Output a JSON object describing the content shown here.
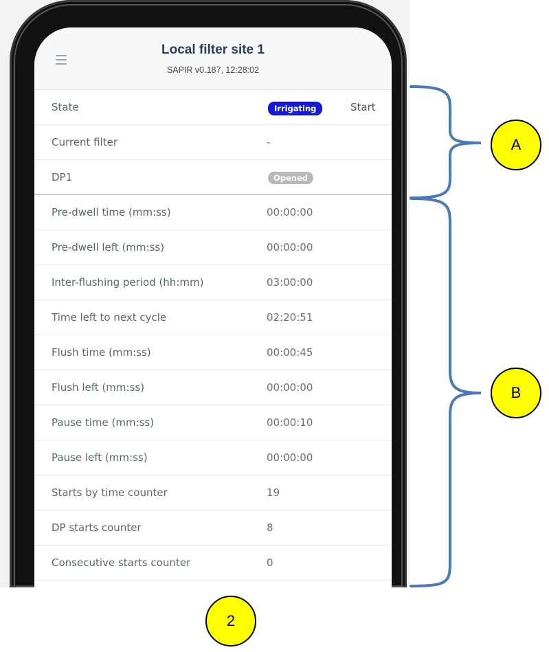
{
  "header": {
    "title": "Local filter site 1",
    "subtitle": "SAPIR v0.187, 12:28:02"
  },
  "section_a": {
    "state": {
      "label": "State",
      "badge": "Irrigating",
      "action": "Start"
    },
    "current_filter": {
      "label": "Current filter",
      "value": "-"
    },
    "dp1": {
      "label": "DP1",
      "badge": "Opened"
    }
  },
  "section_b": [
    {
      "label": "Pre-dwell time (mm:ss)",
      "value": "00:00:00"
    },
    {
      "label": "Pre-dwell left (mm:ss)",
      "value": "00:00:00"
    },
    {
      "label": "Inter-flushing period (hh:mm)",
      "value": "03:00:00"
    },
    {
      "label": "Time left to next cycle",
      "value": "02:20:51"
    },
    {
      "label": "Flush time (mm:ss)",
      "value": "00:00:45"
    },
    {
      "label": "Flush left (mm:ss)",
      "value": "00:00:00"
    },
    {
      "label": "Pause time (mm:ss)",
      "value": "00:00:10"
    },
    {
      "label": "Pause left (mm:ss)",
      "value": "00:00:00"
    },
    {
      "label": "Starts by time counter",
      "value": "19"
    },
    {
      "label": "DP starts counter",
      "value": "8"
    },
    {
      "label": "Consecutive starts counter",
      "value": "0"
    }
  ],
  "callouts": {
    "a": "A",
    "b": "B",
    "two": "2"
  },
  "colors": {
    "bracket": "#4a78b8",
    "badge_active": "#1519e0",
    "badge_inactive": "#b8b8b8",
    "callout": "#ffff00"
  }
}
